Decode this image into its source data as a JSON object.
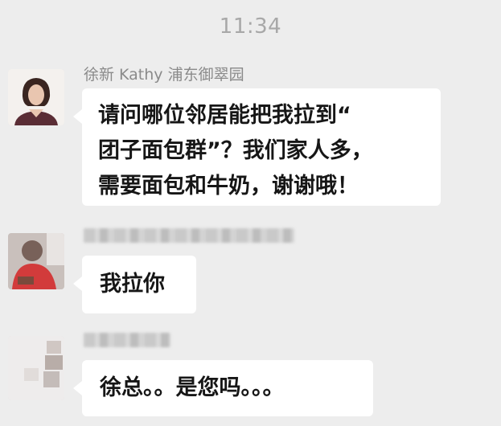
{
  "timestamp": "11:34",
  "messages": [
    {
      "sender": "徐新 Kathy 浦东御翠园",
      "lines": [
        "请问哪位邻居能把我拉到“",
        "团子面包群”？我们家人多，",
        "需要面包和牛奶，谢谢哦！"
      ]
    },
    {
      "sender": "",
      "lines": [
        "我拉你"
      ]
    },
    {
      "sender": "",
      "lines": [
        "徐总。。是您吗。。。"
      ]
    }
  ],
  "colors": {
    "background": "#ededed",
    "bubble": "#ffffff",
    "sender_text": "#8a8a8a",
    "timestamp_text": "#a8a8a8"
  }
}
